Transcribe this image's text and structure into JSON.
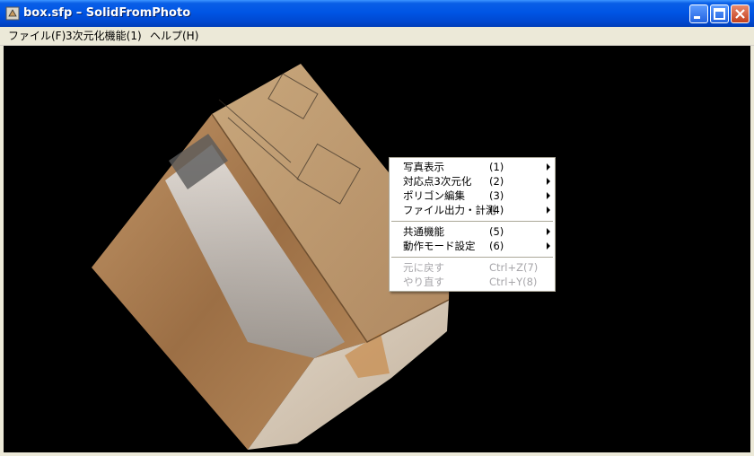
{
  "window": {
    "title": "box.sfp – SolidFromPhoto"
  },
  "menubar": {
    "items": [
      "ファイル(F)",
      "3次元化機能(1)",
      "ヘルプ(H)"
    ]
  },
  "context_menu": {
    "groups": [
      [
        {
          "label": "写真表示",
          "accel": "(1)",
          "submenu": true
        },
        {
          "label": "対応点3次元化",
          "accel": "(2)",
          "submenu": true
        },
        {
          "label": "ポリゴン編集",
          "accel": "(3)",
          "submenu": true
        },
        {
          "label": "ファイル出力・計測",
          "accel": "(4)",
          "submenu": true
        }
      ],
      [
        {
          "label": "共通機能",
          "accel": "(5)",
          "submenu": true
        },
        {
          "label": "動作モード設定",
          "accel": "(6)",
          "submenu": true
        }
      ],
      [
        {
          "label": "元に戻す",
          "accel": "Ctrl+Z(7)",
          "disabled": true
        },
        {
          "label": "やり直す",
          "accel": "Ctrl+Y(8)",
          "disabled": true
        }
      ]
    ]
  },
  "colors": {
    "titlebar": "#0055E5",
    "viewport_bg": "#000000",
    "close_button": "#C4401E"
  }
}
